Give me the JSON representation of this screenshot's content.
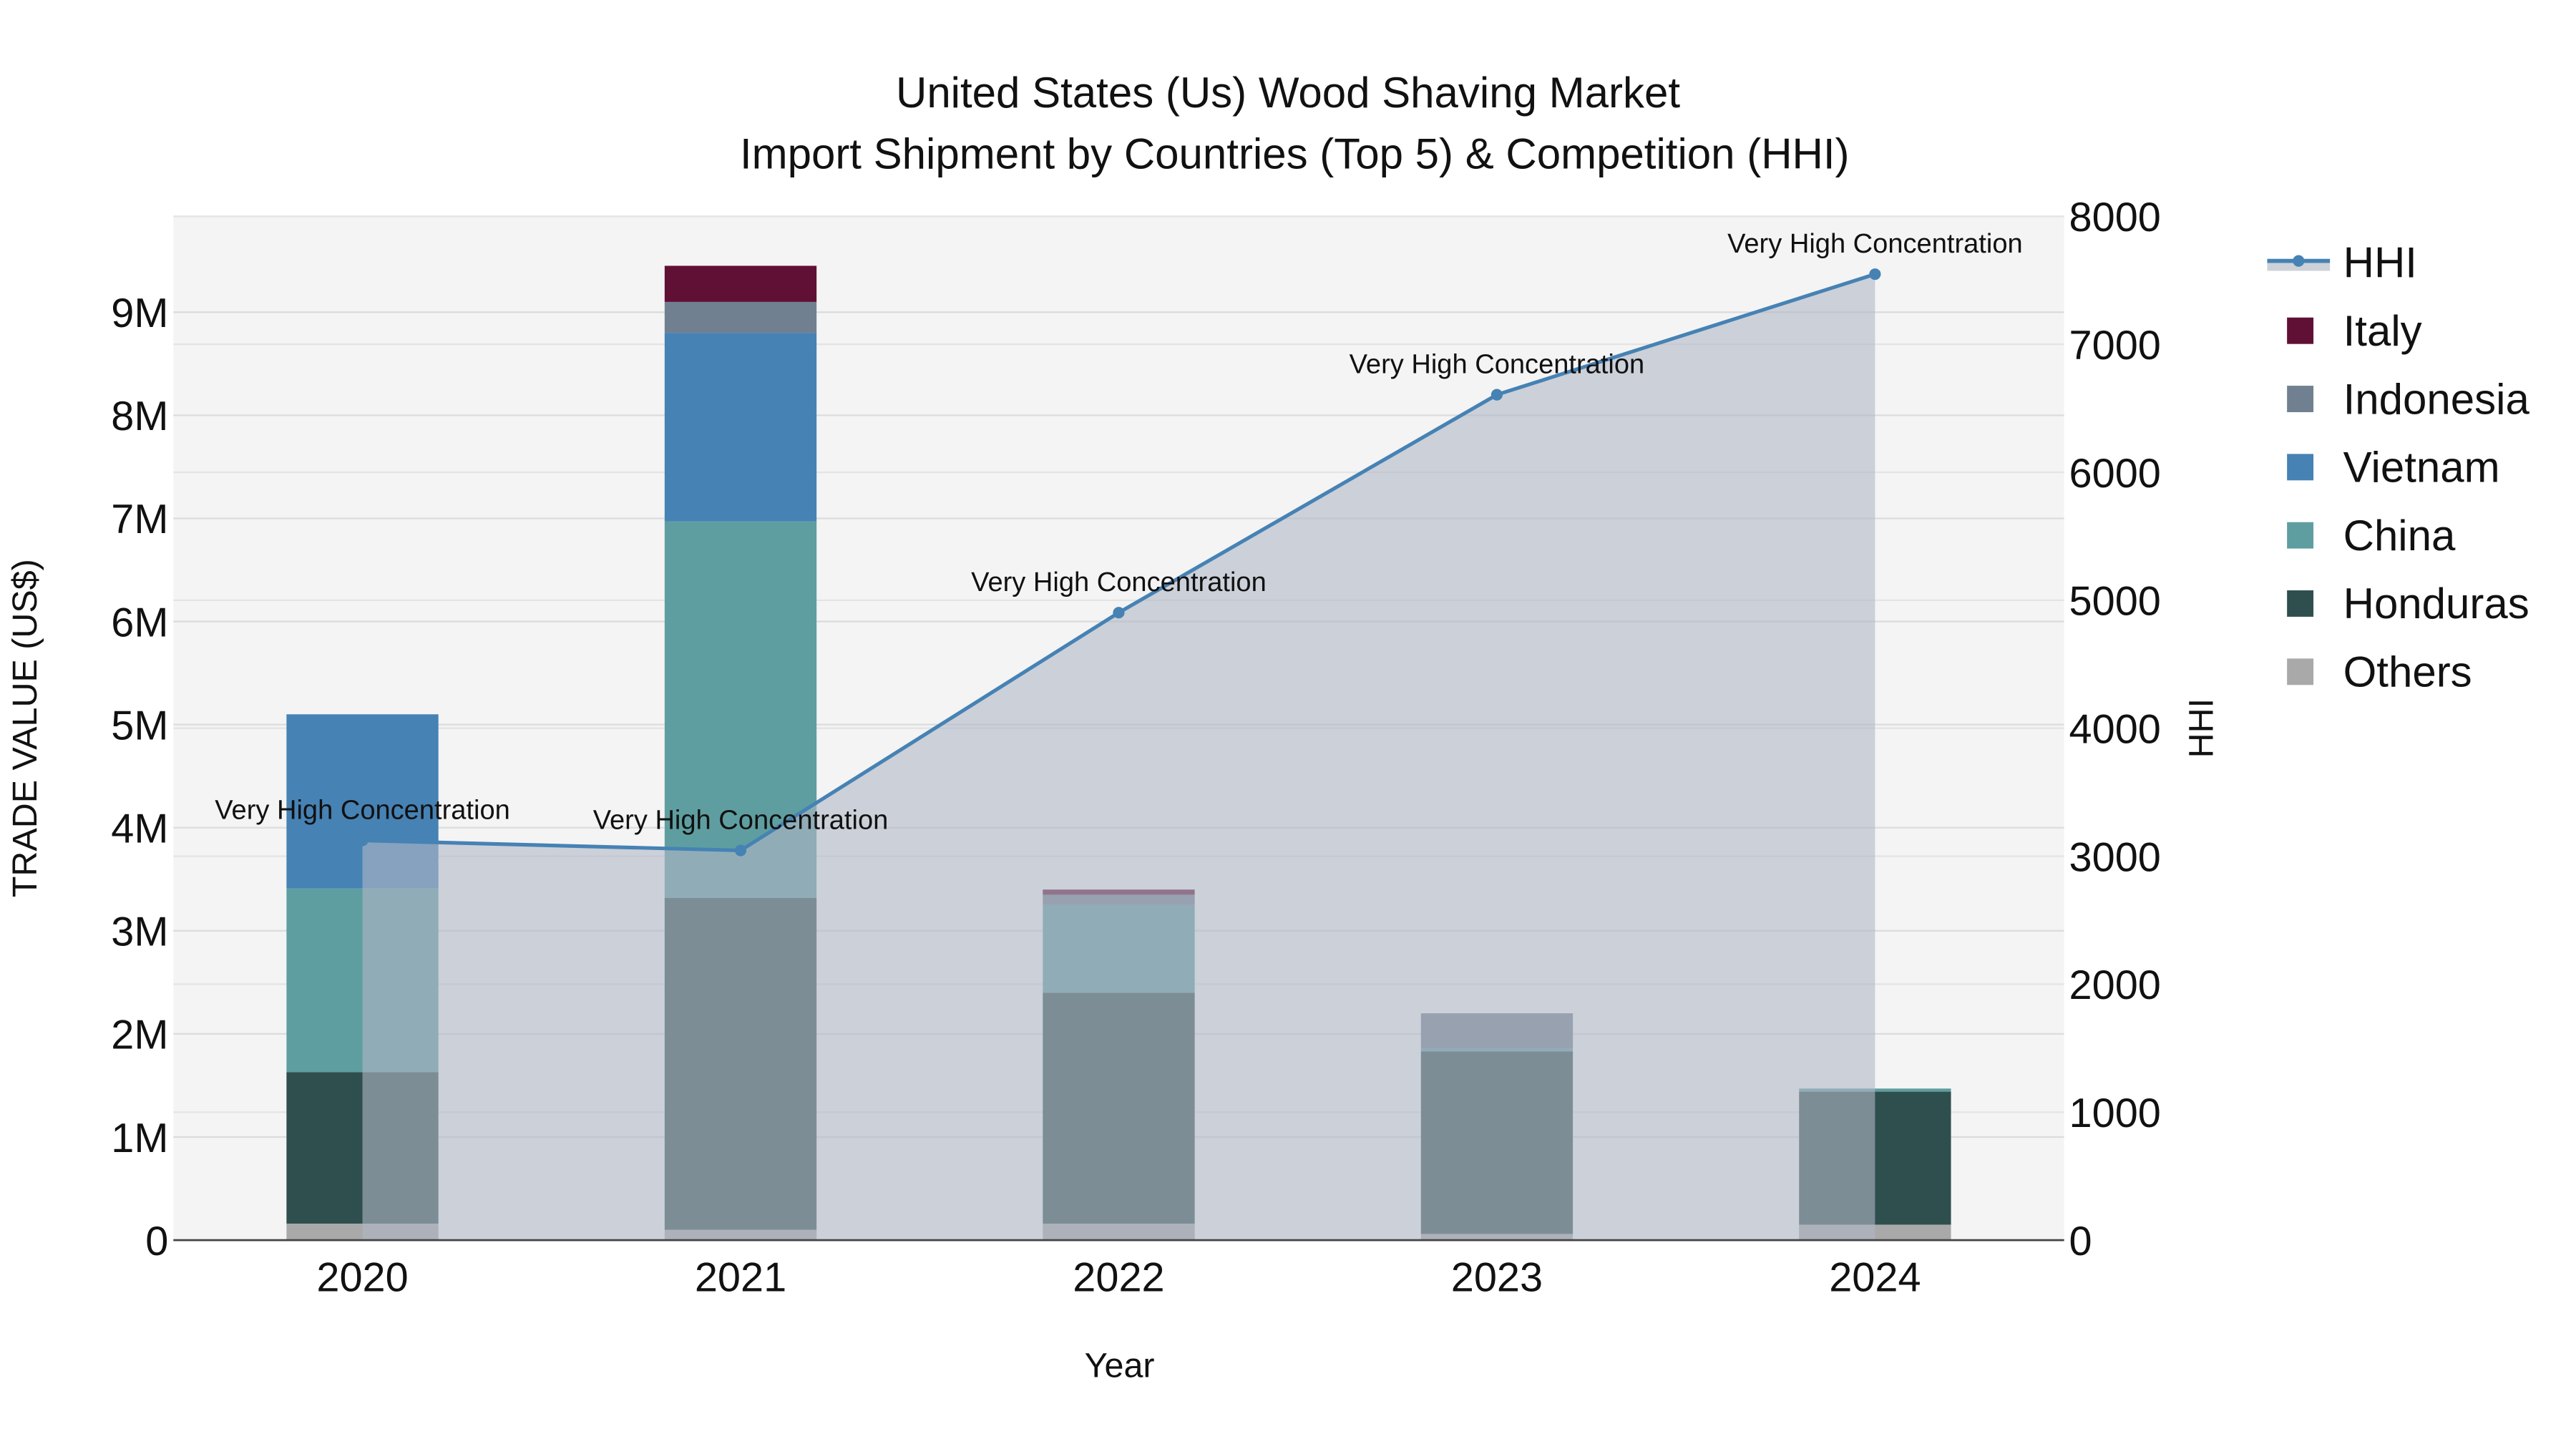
{
  "chart_data": {
    "type": "bar",
    "title": "United States (Us) Wood Shaving Market",
    "subtitle": "Import Shipment by Countries (Top 5) & Competition (HHI)",
    "xlabel": "Year",
    "ylabel": "TRADE VALUE (US$)",
    "y2label": "HHI",
    "categories": [
      "2020",
      "2021",
      "2022",
      "2023",
      "2024"
    ],
    "ylim": [
      0,
      9930000
    ],
    "y2lim": [
      0,
      8000
    ],
    "yticks": [
      0,
      1000000,
      2000000,
      3000000,
      4000000,
      5000000,
      6000000,
      7000000,
      8000000,
      9000000
    ],
    "ytick_labels": [
      "0",
      "1M",
      "2M",
      "3M",
      "4M",
      "5M",
      "6M",
      "7M",
      "8M",
      "9M"
    ],
    "y2ticks": [
      0,
      1000,
      2000,
      3000,
      4000,
      5000,
      6000,
      7000,
      8000
    ],
    "y2tick_labels": [
      "0",
      "1000",
      "2000",
      "3000",
      "4000",
      "5000",
      "6000",
      "7000",
      "8000"
    ],
    "grid": true,
    "legend_position": "right",
    "stacked": true,
    "series": [
      {
        "name": "Others",
        "color": "#a9a9a9",
        "values": [
          160000,
          100000,
          160000,
          60000,
          150000
        ]
      },
      {
        "name": "Honduras",
        "color": "#2f4f4f",
        "values": [
          1470000,
          3220000,
          2240000,
          1770000,
          1290000
        ]
      },
      {
        "name": "China",
        "color": "#5f9ea0",
        "values": [
          1780000,
          3650000,
          850000,
          30000,
          30000
        ]
      },
      {
        "name": "Vietnam",
        "color": "#4682b4",
        "values": [
          1690000,
          1830000,
          0,
          0,
          0
        ]
      },
      {
        "name": "Indonesia",
        "color": "#708090",
        "values": [
          0,
          300000,
          100000,
          340000,
          0
        ]
      },
      {
        "name": "Italy",
        "color": "#601035",
        "values": [
          0,
          350000,
          50000,
          0,
          0
        ]
      }
    ],
    "line": {
      "name": "HHI",
      "color": "#4682b4",
      "fill": "rgba(176,184,198,0.6)",
      "values": [
        3123,
        3045,
        4903,
        6606,
        7548
      ],
      "annotations": [
        "Very High Concentration",
        "Very High Concentration",
        "Very High Concentration",
        "Very High Concentration",
        "Very High Concentration"
      ]
    },
    "legend": [
      "HHI",
      "Italy",
      "Indonesia",
      "Vietnam",
      "China",
      "Honduras",
      "Others"
    ]
  }
}
